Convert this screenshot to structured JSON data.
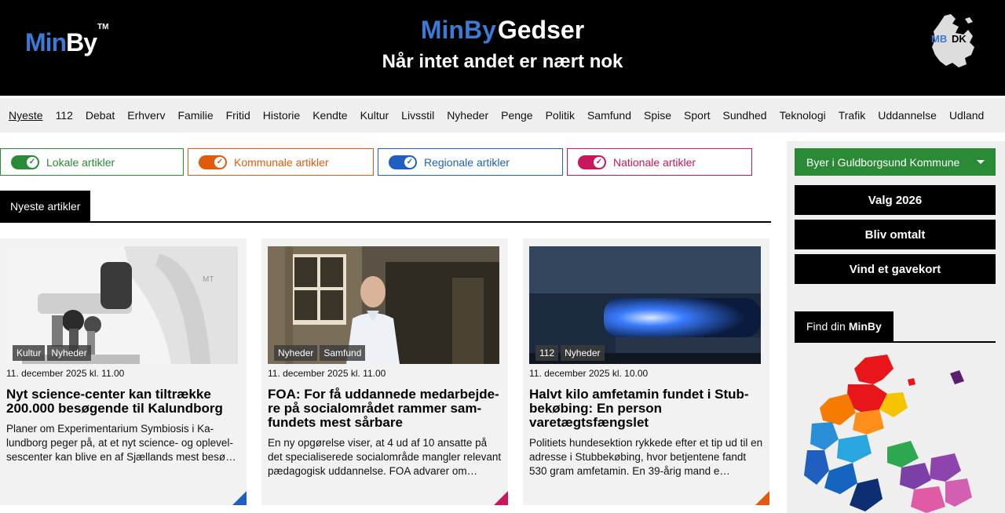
{
  "header": {
    "logo_text": "MinBy",
    "logo_by": "By",
    "logo_min": "Min",
    "logo_tm": "TM",
    "site_prefix": "MinBy",
    "site_town": "Gedser",
    "tagline": "Når intet andet er nært nok",
    "badge_text": "MBDK"
  },
  "nav": [
    "Nyeste",
    "112",
    "Debat",
    "Erhverv",
    "Familie",
    "Fritid",
    "Historie",
    "Kendte",
    "Kultur",
    "Livsstil",
    "Nyheder",
    "Penge",
    "Politik",
    "Samfund",
    "Spise",
    "Sport",
    "Sundhed",
    "Teknologi",
    "Trafik",
    "Uddannelse",
    "Udland"
  ],
  "filters": [
    {
      "label": "Lokale artikler",
      "color": "#2a8a35"
    },
    {
      "label": "Kommunale artikler",
      "color": "#e05a10"
    },
    {
      "label": "Regionale artikler",
      "color": "#1f5fbf"
    },
    {
      "label": "Nationale artikler",
      "color": "#c8175d"
    }
  ],
  "section_title": "Nyeste artikler",
  "articles": [
    {
      "tags": [
        "Kultur",
        "Nyheder"
      ],
      "date": "11. december 2025 kl. 11.00",
      "title": "Nyt science-center kan tiltrække 200.000 besøgende til Kalundborg",
      "lede": "Planer om Experimentarium Symbiosis i Ka­lundborg peger på, at et nyt science- og oplevel­sescenter kan blive en af Sjællands mest besø…",
      "corner_color": "#1f5fbf"
    },
    {
      "tags": [
        "Nyheder",
        "Samfund"
      ],
      "date": "11. december 2025 kl. 11.00",
      "title": "FOA: For få uddannede medarbejde­re på socialområdet rammer sam­fundets mest sårbare",
      "lede": "En ny opgørelse viser, at 4 ud af 10 ansatte på det specialiserede socialområde mangler rele­vant pædagogisk uddannelse. FOA advarer om…",
      "corner_color": "#c8175d"
    },
    {
      "tags": [
        "112",
        "Nyheder"
      ],
      "date": "11. december 2025 kl. 10.00",
      "title": "Halvt kilo amfetamin fundet i Stub­bekøbing: En person varetægtsfængslet",
      "lede": "Politiets hundesektion rykkede efter et tip ud til en adresse i Stubbekøbing, hvor betjentene fandt 530 gram amfetamin. En 39-årig mand e…",
      "corner_color": "#e05a10"
    }
  ],
  "aside": {
    "dropdown_label": "Byer i Guldborgsund Kommune",
    "buttons": [
      "Valg 2026",
      "Bliv omtalt",
      "Vind et gavekort"
    ],
    "find_prefix": "Find din",
    "find_brand": "MinBy"
  }
}
